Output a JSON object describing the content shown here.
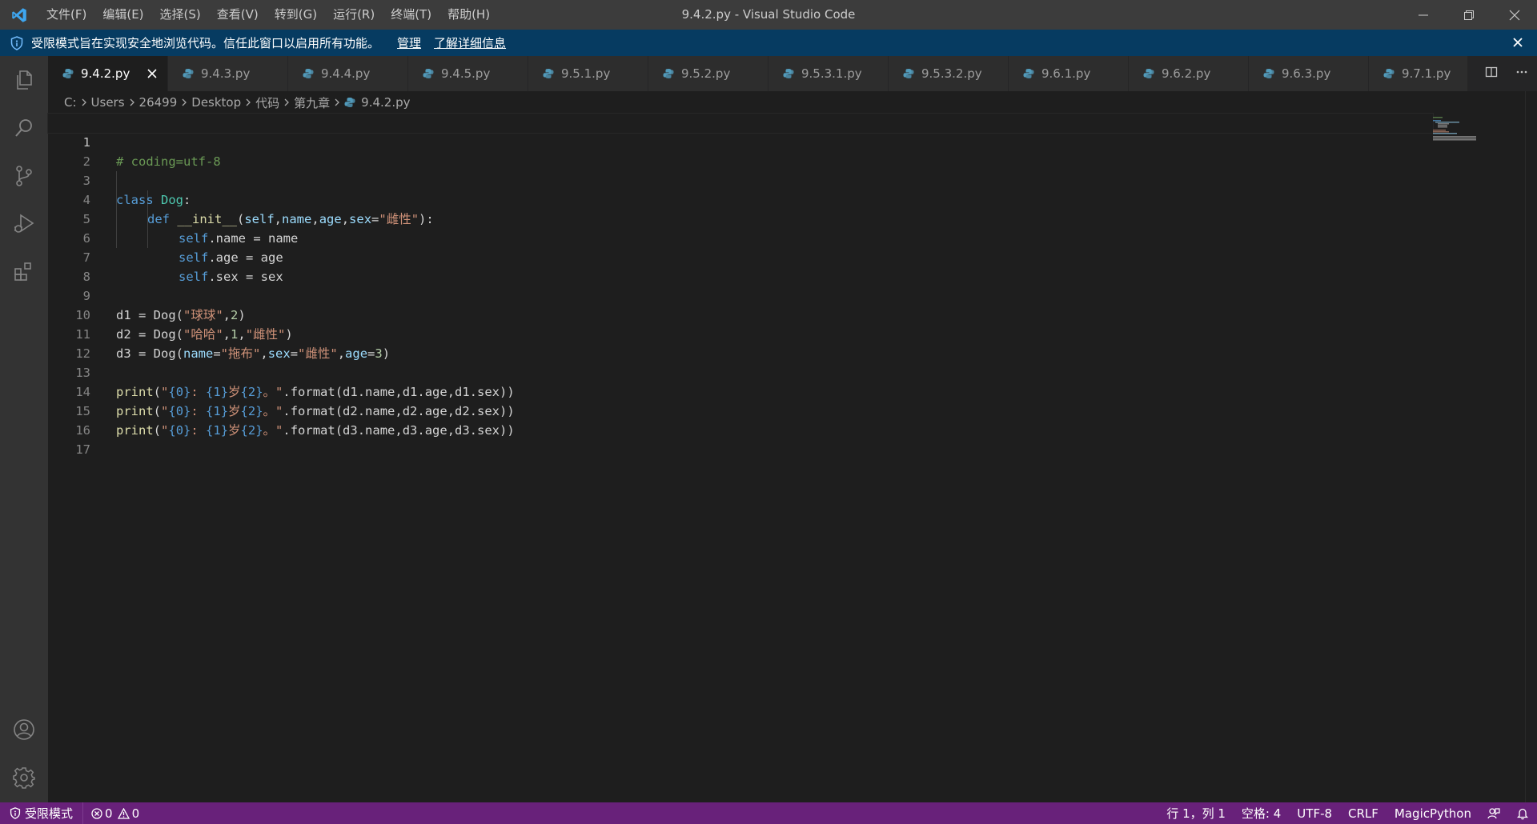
{
  "window": {
    "title": "9.4.2.py - Visual Studio Code",
    "menu": [
      "文件(F)",
      "编辑(E)",
      "选择(S)",
      "查看(V)",
      "转到(G)",
      "运行(R)",
      "终端(T)",
      "帮助(H)"
    ]
  },
  "banner": {
    "text": "受限模式旨在实现安全地浏览代码。信任此窗口以启用所有功能。",
    "manage_label": "管理",
    "learn_more_label": "了解详细信息"
  },
  "tabs": [
    {
      "label": "9.4.2.py",
      "active": true
    },
    {
      "label": "9.4.3.py"
    },
    {
      "label": "9.4.4.py"
    },
    {
      "label": "9.4.5.py"
    },
    {
      "label": "9.5.1.py"
    },
    {
      "label": "9.5.2.py"
    },
    {
      "label": "9.5.3.1.py"
    },
    {
      "label": "9.5.3.2.py"
    },
    {
      "label": "9.6.1.py"
    },
    {
      "label": "9.6.2.py"
    },
    {
      "label": "9.6.3.py"
    },
    {
      "label": "9.7.1.py"
    }
  ],
  "breadcrumb": [
    "C:",
    "Users",
    "26499",
    "Desktop",
    "代码",
    "第九章",
    "9.4.2.py"
  ],
  "editor": {
    "line_numbers": [
      "1",
      "2",
      "3",
      "4",
      "5",
      "6",
      "7",
      "8",
      "9",
      "10",
      "11",
      "12",
      "13",
      "14",
      "15",
      "16",
      "17"
    ],
    "active_line": "1"
  },
  "code": {
    "l1": {
      "a": "# coding=utf-8"
    },
    "l3": {
      "a": "class",
      "b": " ",
      "c": "Dog",
      "d": ":"
    },
    "l4": {
      "a": "def",
      "b": " ",
      "c": "__init__",
      "d": "(",
      "e": "self",
      "f": ",",
      "g": "name",
      "h": ",",
      "i": "age",
      "j": ",",
      "k": "sex",
      "l": "=",
      "m": "\"雌性\"",
      "n": "):"
    },
    "l5": {
      "a": "self",
      "b": ".name = name"
    },
    "l6": {
      "a": "self",
      "b": ".age = age"
    },
    "l7": {
      "a": "self",
      "b": ".sex = sex"
    },
    "l9": {
      "a": "d1 = Dog(",
      "b": "\"球球\"",
      "c": ",",
      "d": "2",
      "e": ")"
    },
    "l10": {
      "a": "d2 = Dog(",
      "b": "\"哈哈\"",
      "c": ",",
      "d": "1",
      "e": ",",
      "f": "\"雌性\"",
      "g": ")"
    },
    "l11": {
      "a": "d3 = Dog(",
      "b": "name",
      "c": "=",
      "d": "\"拖布\"",
      "e": ",",
      "f": "sex",
      "g": "=",
      "h": "\"雌性\"",
      "i": ",",
      "j": "age",
      "k": "=",
      "l": "3",
      "m": ")"
    },
    "l13": {
      "a": "print",
      "b": "(",
      "c": "\"",
      "d": "{0}",
      "e": ": ",
      "f": "{1}",
      "g": "岁",
      "h": "{2}",
      "i": "。\"",
      "j": ".format(d1.name,d1.age,d1.sex))"
    },
    "l14": {
      "a": "print",
      "b": "(",
      "c": "\"",
      "d": "{0}",
      "e": ": ",
      "f": "{1}",
      "g": "岁",
      "h": "{2}",
      "i": "。\"",
      "j": ".format(d2.name,d2.age,d2.sex))"
    },
    "l15": {
      "a": "print",
      "b": "(",
      "c": "\"",
      "d": "{0}",
      "e": ": ",
      "f": "{1}",
      "g": "岁",
      "h": "{2}",
      "i": "。\"",
      "j": ".format(d3.name,d3.age,d3.sex))"
    }
  },
  "statusbar": {
    "restricted_label": "受限模式",
    "errors": "0",
    "warnings": "0",
    "position": "行 1，列 1",
    "spaces": "空格: 4",
    "encoding": "UTF-8",
    "eol": "CRLF",
    "language": "MagicPython"
  },
  "colors": {
    "statusbar_bg": "#68217a",
    "banner_bg": "#063b61",
    "accent_blue": "#007acc"
  }
}
